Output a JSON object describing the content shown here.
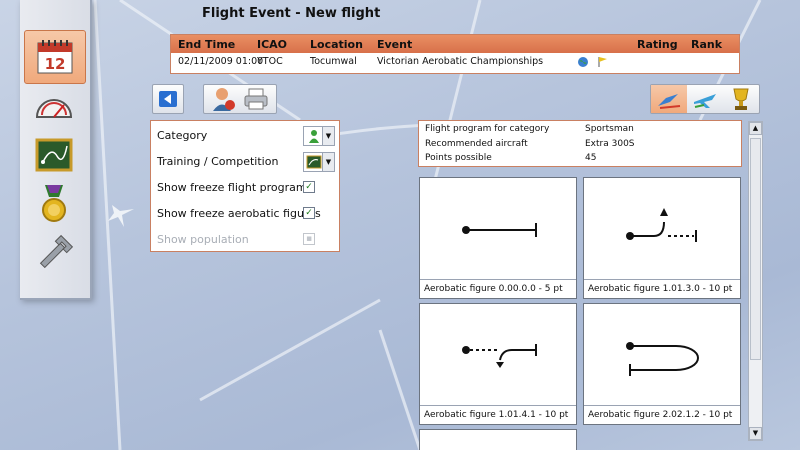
{
  "header": {
    "title": "Flight Event  -  New flight"
  },
  "event_table": {
    "columns": [
      "End Time",
      "ICAO",
      "Location",
      "Event",
      "Rating",
      "Rank"
    ],
    "row": {
      "end_time": "02/11/2009 01:00",
      "icao": "YTOC",
      "location": "Tocumwal",
      "event": "Victorian Aerobatic Championships"
    }
  },
  "sidebar": {
    "calendar_day": "12",
    "items": [
      "calendar-icon",
      "gauge-icon",
      "chalkboard-icon",
      "medal-icon",
      "wrench-icon"
    ]
  },
  "options": {
    "category_label": "Category",
    "training_label": "Training / Competition",
    "freeze_program_label": "Show freeze flight program",
    "freeze_program_checked": true,
    "freeze_figures_label": "Show freeze aerobatic figures",
    "freeze_figures_checked": true,
    "population_label": "Show population",
    "population_checked": false
  },
  "info": {
    "program_label": "Flight program for category",
    "program_value": "Sportsman",
    "aircraft_label": "Recommended aircraft",
    "aircraft_value": "Extra 300S",
    "points_label": "Points possible",
    "points_value": "45"
  },
  "figures": [
    {
      "caption": "Aerobatic figure 0.00.0.0 -    5 pt"
    },
    {
      "caption": "Aerobatic figure 1.01.3.0 -   10 pt"
    },
    {
      "caption": "Aerobatic figure 1.01.4.1 -   10 pt"
    },
    {
      "caption": "Aerobatic figure 2.02.1.2 -   10 pt"
    }
  ],
  "colors": {
    "accent": "#e07a50",
    "panel_border": "#c98062"
  }
}
